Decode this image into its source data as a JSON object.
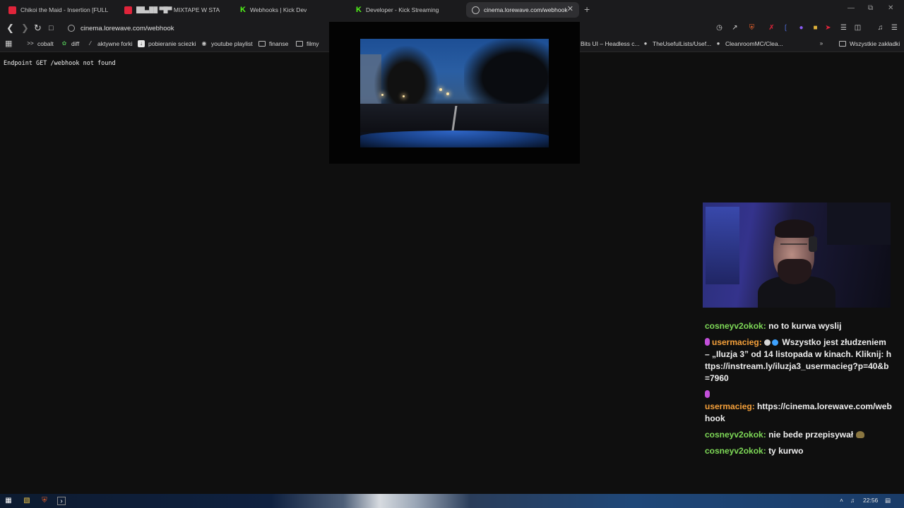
{
  "browser": {
    "tabs": [
      {
        "label": "Chikoi the Maid - Insertion [FULL ALB",
        "icon": "youtube-icon",
        "active": false
      },
      {
        "label": "██▄██ ▀█▀ MIXTAPE W STA",
        "icon": "youtube-icon",
        "active": false
      },
      {
        "label": "Webhooks | Kick Dev",
        "icon": "kick-icon",
        "active": false
      },
      {
        "label": "Developer - Kick Streaming",
        "icon": "kick-icon",
        "active": false
      },
      {
        "label": "cinema.lorewave.com/webhook",
        "icon": "site-info-icon",
        "active": true
      }
    ],
    "close_glyph": "✕",
    "new_tab_glyph": "+",
    "url": "cinema.lorewave.com/webhook",
    "window_controls": {
      "minimize": "—",
      "restore": "⧉",
      "close": "✕"
    }
  },
  "bookmarks": [
    {
      "label": "cobalt",
      "icon": "cobalt-icon"
    },
    {
      "label": "diff",
      "icon": "diff-icon"
    },
    {
      "label": "aktywne forki",
      "icon": "fork-icon"
    },
    {
      "label": "pobieranie sciezki",
      "icon": "download-icon"
    },
    {
      "label": "youtube playlist",
      "icon": "globe-icon"
    },
    {
      "label": "finanse",
      "icon": "folder-icon"
    },
    {
      "label": "filmy",
      "icon": "folder-icon"
    },
    {
      "label": "Bits UI – Headless c...",
      "icon": "bits-icon"
    },
    {
      "label": "TheUsefulLists/Usef...",
      "icon": "github-icon"
    },
    {
      "label": "CleanroomMC/Clea...",
      "icon": "github-icon"
    },
    {
      "label": "Wszystkie zakładki",
      "icon": "folder-icon"
    }
  ],
  "page": {
    "message": "Endpoint GET /webhook not found"
  },
  "chat": {
    "messages": [
      {
        "user": "cosneyv2okok:",
        "text": "no to kurwa wyslij",
        "color": "#7ed957"
      },
      {
        "user": "usermacieg:",
        "text": "Wszystko jest złudzeniem – „Iluzja 3” od 14 listopada w kinach. Kliknij: https://instream.ly/iluzja3_usermacieg?p=40&b=7960",
        "color": "#f5a03a"
      },
      {
        "user": "usermacieg:",
        "text": "https://cinema.lorewave.com/webhook",
        "color": "#f5a03a"
      },
      {
        "user": "cosneyv2okok:",
        "text": "nie bede przepisywał",
        "color": "#7ed957"
      },
      {
        "user": "cosneyv2okok:",
        "text": "ty kurwo",
        "color": "#7ed957"
      }
    ]
  },
  "taskbar": {
    "clock": "22:56"
  }
}
